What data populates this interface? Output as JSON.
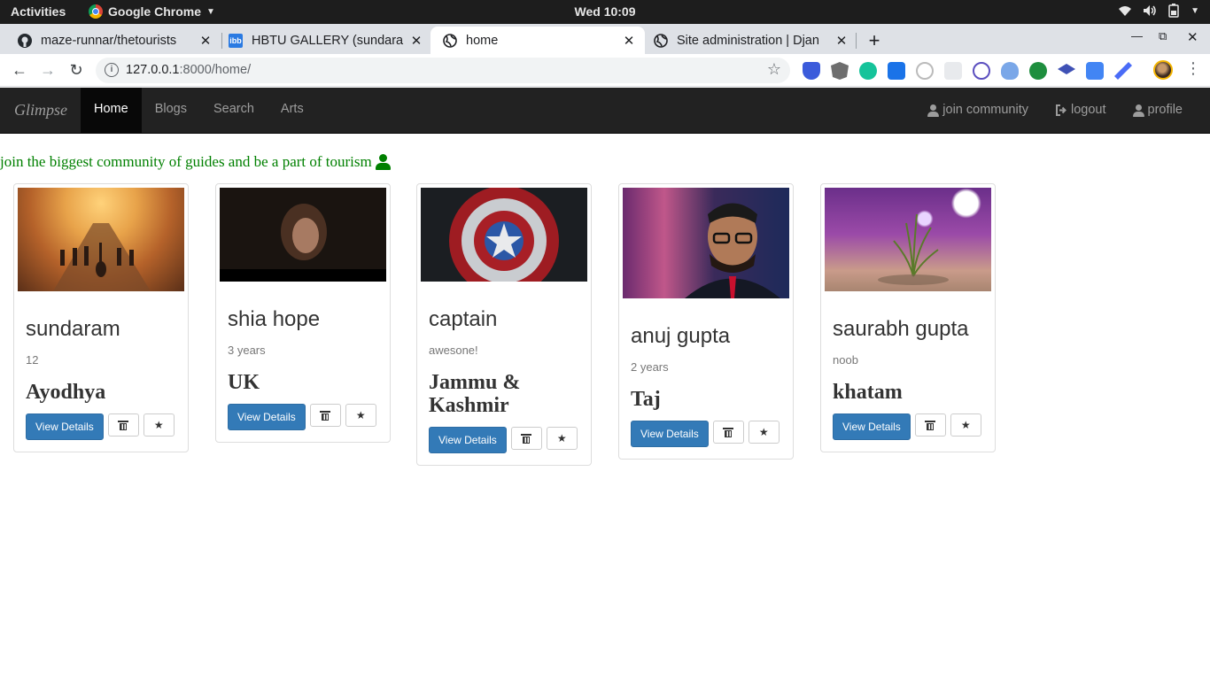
{
  "os": {
    "activities": "Activities",
    "app_name": "Google Chrome",
    "clock": "Wed 10:09"
  },
  "browser": {
    "tabs": [
      {
        "label": "maze-runnar/thetourists",
        "favicon": "github-icon"
      },
      {
        "label": "HBTU GALLERY (sundaram",
        "favicon": "ibb-icon"
      },
      {
        "label": "home",
        "favicon": "globe-icon",
        "active": true
      },
      {
        "label": "Site administration | Djan",
        "favicon": "globe-icon"
      }
    ],
    "url_host": "127.0.0.1",
    "url_rest": ":8000/home/"
  },
  "navbar": {
    "brand": "Glimpse",
    "links": [
      "Home",
      "Blogs",
      "Search",
      "Arts"
    ],
    "active": "Home",
    "right_links": [
      "join community",
      "logout",
      "profile"
    ]
  },
  "tagline": "join the biggest community of guides and be a part of tourism",
  "cards": [
    {
      "name": "sundaram",
      "sub": "12",
      "place": "Ayodhya",
      "button": "View Details"
    },
    {
      "name": "shia hope",
      "sub": "3 years",
      "place": "UK",
      "button": "View Details"
    },
    {
      "name": "captain",
      "sub": "awesone!",
      "place": "Jammu & Kashmir",
      "button": "View Details"
    },
    {
      "name": "anuj gupta",
      "sub": "2 years",
      "place": "Taj",
      "button": "View Details"
    },
    {
      "name": "saurabh gupta",
      "sub": "noob",
      "place": "khatam",
      "button": "View Details"
    }
  ],
  "colors": {
    "navbar_bg": "#222222",
    "primary": "#337ab7",
    "tagline": "#008000"
  }
}
